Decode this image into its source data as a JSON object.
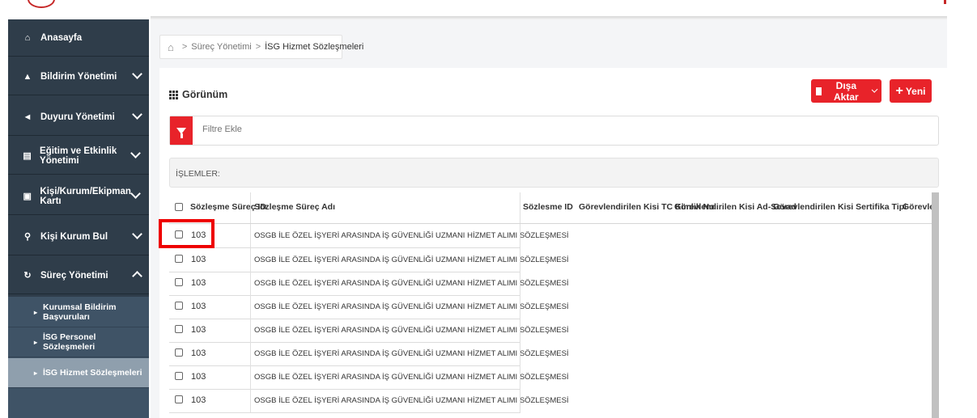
{
  "sidebar": {
    "items": [
      {
        "label": "Anasayfa",
        "icon": "home-icon"
      },
      {
        "label": "Bildirim Yönetimi",
        "icon": "bell-icon"
      },
      {
        "label": "Duyuru Yönetimi",
        "icon": "megaphone-icon"
      },
      {
        "label": "Eğitim ve Etkinlik Yönetimi",
        "icon": "list-icon"
      },
      {
        "label": "Kişi/Kurum/Ekipman Kartı",
        "icon": "id-card-icon"
      },
      {
        "label": "Kişi Kurum Bul",
        "icon": "search-icon"
      },
      {
        "label": "Süreç Yönetimi",
        "icon": "refresh-icon"
      }
    ],
    "subitems": [
      {
        "label": "Kurumsal Bildirim Başvuruları"
      },
      {
        "label": "İSG Personel Sözleşmeleri"
      },
      {
        "label": "İSG Hizmet Sözleşmeleri"
      }
    ]
  },
  "breadcrumb": {
    "level1": "Süreç Yönetimi",
    "level2": "İSG Hizmet Sözleşmeleri"
  },
  "view": {
    "title": "Görünüm"
  },
  "toolbar": {
    "export_label": "Dışa Aktar",
    "new_label": "Yeni"
  },
  "filter": {
    "placeholder": "Filtre Ekle"
  },
  "operations": {
    "label": "İŞLEMLER:"
  },
  "table": {
    "headers": [
      "Sözleşme Süreç ID",
      "Sözleşme Süreç Adı",
      "Sözlesme ID",
      "Görevlendirilen Kisi TC Kimlik No",
      "Görevlendirilen Kisi Ad-Sovad",
      "Görevlendirilen Kisi Sertifika Tipi",
      "Görevlendi"
    ],
    "rows": [
      {
        "id": "103",
        "name": "OSGB İLE ÖZEL İŞYERİ ARASINDA İŞ GÜVENLİĞİ UZMANI HİZMET ALIMI SÖZLEŞMESİ"
      },
      {
        "id": "103",
        "name": "OSGB İLE ÖZEL İŞYERİ ARASINDA İŞ GÜVENLİĞİ UZMANI HİZMET ALIMI SÖZLEŞMESİ"
      },
      {
        "id": "103",
        "name": "OSGB İLE ÖZEL İŞYERİ ARASINDA İŞ GÜVENLİĞİ UZMANI HİZMET ALIMI SÖZLEŞMESİ"
      },
      {
        "id": "103",
        "name": "OSGB İLE ÖZEL İŞYERİ ARASINDA İŞ GÜVENLİĞİ UZMANI HİZMET ALIMI SÖZLEŞMESİ"
      },
      {
        "id": "103",
        "name": "OSGB İLE ÖZEL İŞYERİ ARASINDA İŞ GÜVENLİĞİ UZMANI HİZMET ALIMI SÖZLEŞMESİ"
      },
      {
        "id": "103",
        "name": "OSGB İLE ÖZEL İŞYERİ ARASINDA İŞ GÜVENLİĞİ UZMANI HİZMET ALIMI SÖZLEŞMESİ"
      },
      {
        "id": "103",
        "name": "OSGB İLE ÖZEL İŞYERİ ARASINDA İŞ GÜVENLİĞİ UZMANI HİZMET ALIMI SÖZLEŞMESİ"
      },
      {
        "id": "103",
        "name": "OSGB İLE ÖZEL İŞYERİ ARASINDA İŞ GÜVENLİĞİ UZMANI HİZMET ALIMI SÖZLEŞMESİ"
      }
    ]
  },
  "colors": {
    "sidebar_bg": "#2f3d4a",
    "submenu_bg": "#3f5366",
    "active_sub_bg": "#8f9fad",
    "accent_red": "#e8232a",
    "highlight_border": "#ee0000"
  }
}
